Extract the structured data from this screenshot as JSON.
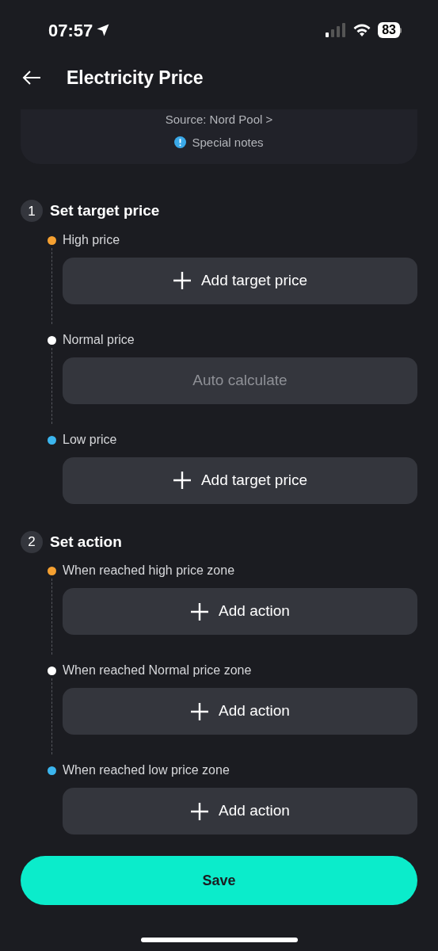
{
  "status_bar": {
    "time": "07:57",
    "battery": "83"
  },
  "header": {
    "title": "Electricity Price"
  },
  "info_card": {
    "source": "Source: Nord Pool >",
    "notes": "Special notes"
  },
  "sections": [
    {
      "number": "1",
      "title": "Set target price",
      "items": [
        {
          "label": "High price",
          "color": "#f5a031",
          "kind": "add",
          "button": "Add target price"
        },
        {
          "label": "Normal price",
          "color": "#ffffff",
          "kind": "auto",
          "button": "Auto calculate"
        },
        {
          "label": "Low price",
          "color": "#3bb5ee",
          "kind": "add",
          "button": "Add target price"
        }
      ]
    },
    {
      "number": "2",
      "title": "Set action",
      "items": [
        {
          "label": "When reached high price zone",
          "color": "#f5a031",
          "kind": "add",
          "button": "Add action"
        },
        {
          "label": "When reached Normal price zone",
          "color": "#ffffff",
          "kind": "add",
          "button": "Add action"
        },
        {
          "label": "When reached low price zone",
          "color": "#3bb5ee",
          "kind": "add",
          "button": "Add action"
        }
      ]
    }
  ],
  "save_button": "Save"
}
